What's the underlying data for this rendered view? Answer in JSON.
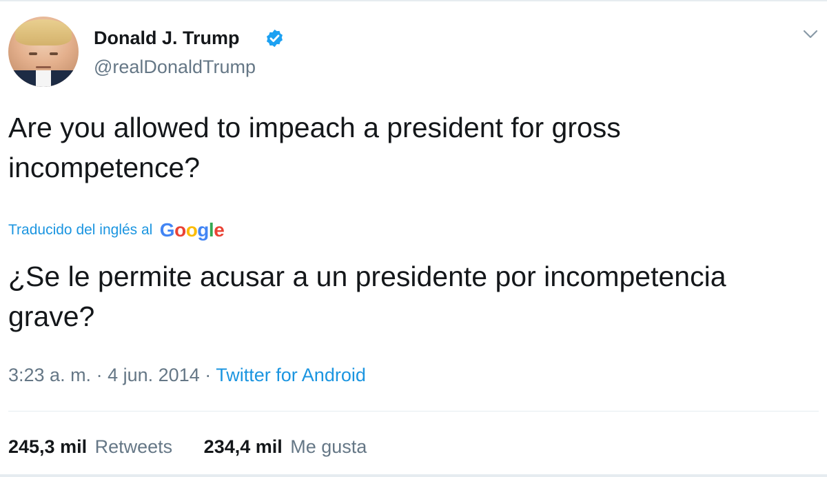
{
  "author": {
    "display_name": "Donald J. Trump",
    "handle": "@realDonaldTrump",
    "verified": true
  },
  "tweet": {
    "text": "Are you allowed to impeach a president for gross incompetence?",
    "translation_label": "Traducido del inglés al",
    "translation_provider": "Google",
    "translated_text": "¿Se le permite acusar a un presidente por incompetencia grave?"
  },
  "meta": {
    "time": "3:23 a. m.",
    "separator": "·",
    "date": "4 jun. 2014",
    "source": "Twitter for Android"
  },
  "stats": {
    "retweets_count": "245,3 mil",
    "retweets_label": "Retweets",
    "likes_count": "234,4 mil",
    "likes_label": "Me gusta"
  },
  "icons": {
    "verified": "verified-badge-icon",
    "more": "chevron-down-icon",
    "avatar": "profile-photo"
  },
  "colors": {
    "accent": "#1b95e0",
    "muted": "#657786",
    "text": "#14171a",
    "verified": "#1da1f2"
  }
}
